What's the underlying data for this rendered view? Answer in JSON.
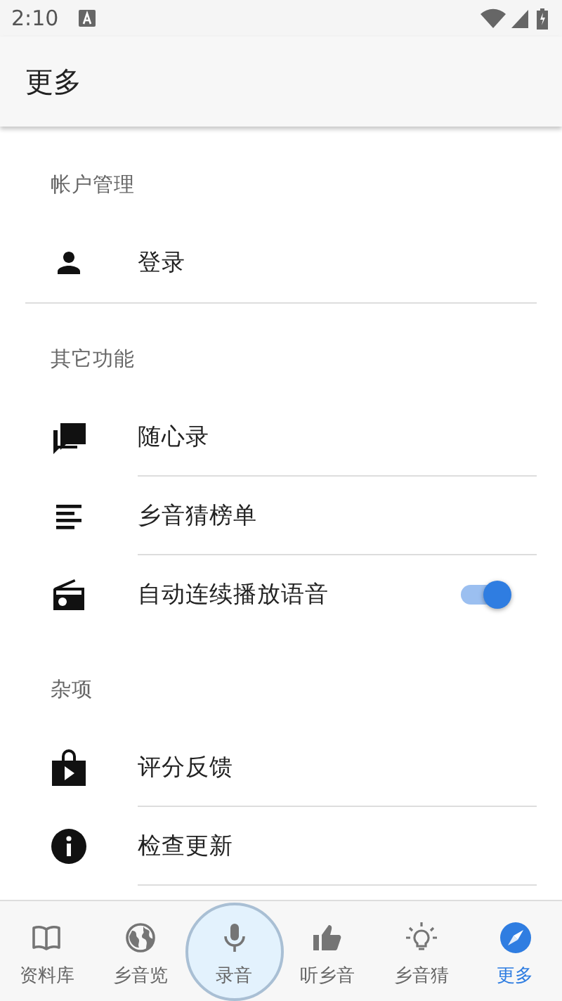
{
  "status_bar": {
    "time": "2:10"
  },
  "app_bar": {
    "title": "更多"
  },
  "sections": [
    {
      "header": "帐户管理",
      "items": [
        {
          "kind": "link",
          "label": "登录"
        }
      ]
    },
    {
      "header": "其它功能",
      "items": [
        {
          "kind": "link",
          "label": "随心录"
        },
        {
          "kind": "link",
          "label": "乡音猜榜单"
        },
        {
          "kind": "toggle",
          "label": "自动连续播放语音",
          "on": true
        }
      ]
    },
    {
      "header": "杂项",
      "items": [
        {
          "kind": "link",
          "label": "评分反馈"
        },
        {
          "kind": "link",
          "label": "检查更新"
        }
      ]
    }
  ],
  "bottom_nav": [
    {
      "kind": "tab",
      "label": "资料库",
      "selected": false
    },
    {
      "kind": "tab",
      "label": "乡音览",
      "selected": false
    },
    {
      "kind": "record",
      "label": "录音",
      "selected": false
    },
    {
      "kind": "tab",
      "label": "听乡音",
      "selected": false
    },
    {
      "kind": "tab",
      "label": "乡音猜",
      "selected": false
    },
    {
      "kind": "tab",
      "label": "更多",
      "selected": true
    }
  ]
}
